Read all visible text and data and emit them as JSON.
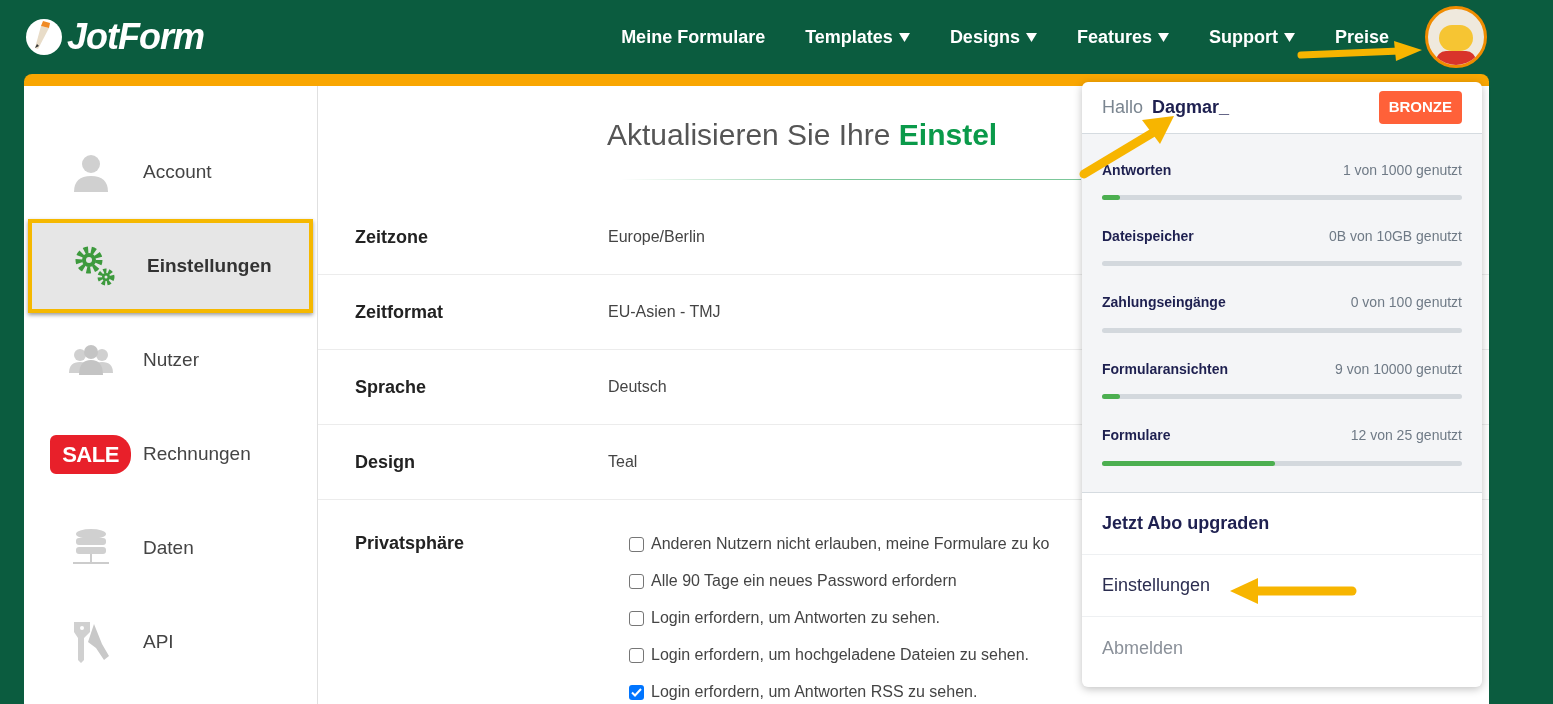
{
  "brand": "JotForm",
  "nav": [
    {
      "label": "Meine Formulare",
      "dropdown": false
    },
    {
      "label": "Templates",
      "dropdown": true
    },
    {
      "label": "Designs",
      "dropdown": true
    },
    {
      "label": "Features",
      "dropdown": true
    },
    {
      "label": "Support",
      "dropdown": true
    },
    {
      "label": "Preise",
      "dropdown": false
    }
  ],
  "sidebar": {
    "items": [
      {
        "label": "Account",
        "kind": "account",
        "selected": false
      },
      {
        "label": "Einstellungen",
        "kind": "settings",
        "selected": true
      },
      {
        "label": "Nutzer",
        "kind": "users",
        "selected": false
      },
      {
        "label": "Rechnungen",
        "kind": "sale",
        "badge": "SALE",
        "selected": false
      },
      {
        "label": "Daten",
        "kind": "data",
        "selected": false
      },
      {
        "label": "API",
        "kind": "api",
        "selected": false
      }
    ]
  },
  "page_title": "Aktualisieren Sie Ihre **Einstel**",
  "settings": [
    {
      "label": "Zeitzone",
      "value": "Europe/Berlin"
    },
    {
      "label": "Zeitformat",
      "value": "EU-Asien - TMJ"
    },
    {
      "label": "Sprache",
      "value": "Deutsch"
    },
    {
      "label": "Design",
      "value": "Teal"
    },
    {
      "label": "Privatsphäre",
      "options": [
        {
          "text": "Anderen Nutzern nicht erlauben, meine Formulare zu ko",
          "checked": false
        },
        {
          "text": "Alle 90 Tage ein neues Password erfordern",
          "checked": false
        },
        {
          "text": "Login erfordern, um Antworten zu sehen.",
          "checked": false
        },
        {
          "text": "Login erfordern, um hochgeladene Dateien zu sehen.",
          "checked": false
        },
        {
          "text": "Login erfordern, um Antworten RSS zu sehen.",
          "checked": true
        }
      ]
    }
  ],
  "account_menu": {
    "greeting": "Hallo",
    "username": "Dagmar_",
    "plan": "BRONZE",
    "usage": [
      {
        "label": "Antworten",
        "reading": "1 von 1000 genutzt",
        "level": 0.05
      },
      {
        "label": "Dateispeicher",
        "reading": "0B von 10GB genutzt",
        "level": 0
      },
      {
        "label": "Zahlungseingänge",
        "reading": "0 von 100 genutzt",
        "level": 0
      },
      {
        "label": "Formularansichten",
        "reading": "9 von 10000 genutzt",
        "level": 0.05
      },
      {
        "label": "Formulare",
        "reading": "12 von 25 genutzt",
        "level": 0.48
      }
    ],
    "links": [
      {
        "label": "Jetzt Abo upgraden",
        "kind": "upgrade"
      },
      {
        "label": "Einstellungen",
        "kind": "link"
      },
      {
        "label": "Abmelden",
        "kind": "muted"
      }
    ]
  }
}
